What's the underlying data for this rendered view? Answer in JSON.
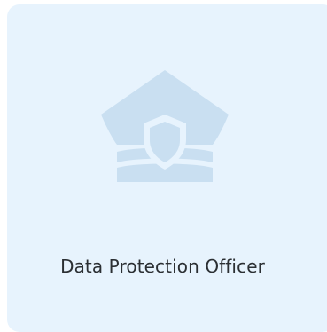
{
  "card": {
    "title": "Data Protection Officer",
    "icon": "officer-cap-shield-icon"
  },
  "colors": {
    "card_background": "#e7f3fd",
    "icon_fill": "#c9dff1",
    "icon_cutout": "#e7f3fd",
    "text": "#2b2f33"
  }
}
